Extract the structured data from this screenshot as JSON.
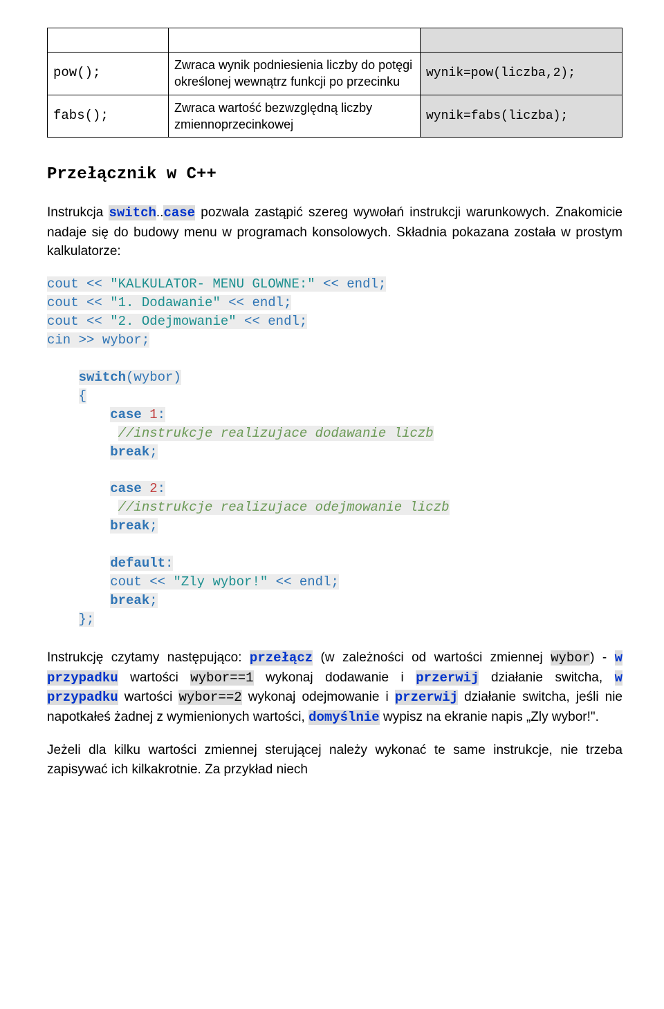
{
  "table": {
    "rows": [
      {
        "fn": "pow();",
        "desc": "Zwraca wynik podniesienia liczby do potęgi określonej wewnątrz funkcji po przecinku",
        "ex": "wynik=pow(liczba,2);"
      },
      {
        "fn": "fabs();",
        "desc": "Zwraca wartość bezwzględną liczby zmiennoprzecinkowej",
        "ex": "wynik=fabs(liczba);"
      }
    ]
  },
  "heading": "Przełącznik w C++",
  "p1": {
    "pre": "Instrukcja ",
    "kw1": "switch",
    "mid1": "..",
    "kw2": "case",
    "rest": " pozwala zastąpić szereg wywołań instrukcji warunkowych. Znakomicie nadaje się do budowy menu w programach konsolowych. Składnia pokazana została w prostym kalkulatorze:"
  },
  "code": {
    "l1a": "cout << ",
    "l1b": "\"KALKULATOR- MENU GLOWNE:\"",
    "l1c": " << endl;",
    "l2a": "cout << ",
    "l2b": "\"1. Dodawanie\"",
    "l2c": " << endl;",
    "l3a": "cout << ",
    "l3b": "\"2. Odejmowanie\"",
    "l3c": " << endl;",
    "l4": "cin >> wybor;",
    "sw": "switch",
    "swp": "(wybor)",
    "ob": "{",
    "case": "case",
    "one": " 1",
    "colon": ":",
    "cmt1": "//instrukcje realizujace dodawanie liczb",
    "brk": "break",
    "sc": ";",
    "two": " 2",
    "cmt2": "//instrukcje realizujace odejmowanie liczb",
    "def": "default",
    "dcolon": ":",
    "da": "cout << ",
    "db": "\"Zly wybor!\"",
    "dc": " << endl;",
    "cb": "};"
  },
  "p2": {
    "t1": "Instrukcję czytamy następująco: ",
    "h1": "przełącz",
    "t2": " (w zależności od wartości zmiennej ",
    "m1": "wybor",
    "t3": ") - ",
    "h2": "w przypadku",
    "t4": " wartości ",
    "m2": "wybor==1",
    "t5": " wykonaj dodawanie i ",
    "h3": "przerwij",
    "t6": " działanie switcha, ",
    "h4": "w przypadku",
    "t7": " wartości ",
    "m3": "wybor==2",
    "t8": " wykonaj odejmowanie i ",
    "h5": "przerwij",
    "t9": " działanie switcha, jeśli nie napotkałeś żadnej z wymienionych wartości, ",
    "h6": "domyślnie",
    "t10": " wypisz na ekranie napis „Zly wybor!\"."
  },
  "p3": "Jeżeli dla kilku wartości zmiennej sterującej należy wykonać te same instrukcje, nie trzeba zapisywać ich kilkakrotnie. Za przykład niech"
}
